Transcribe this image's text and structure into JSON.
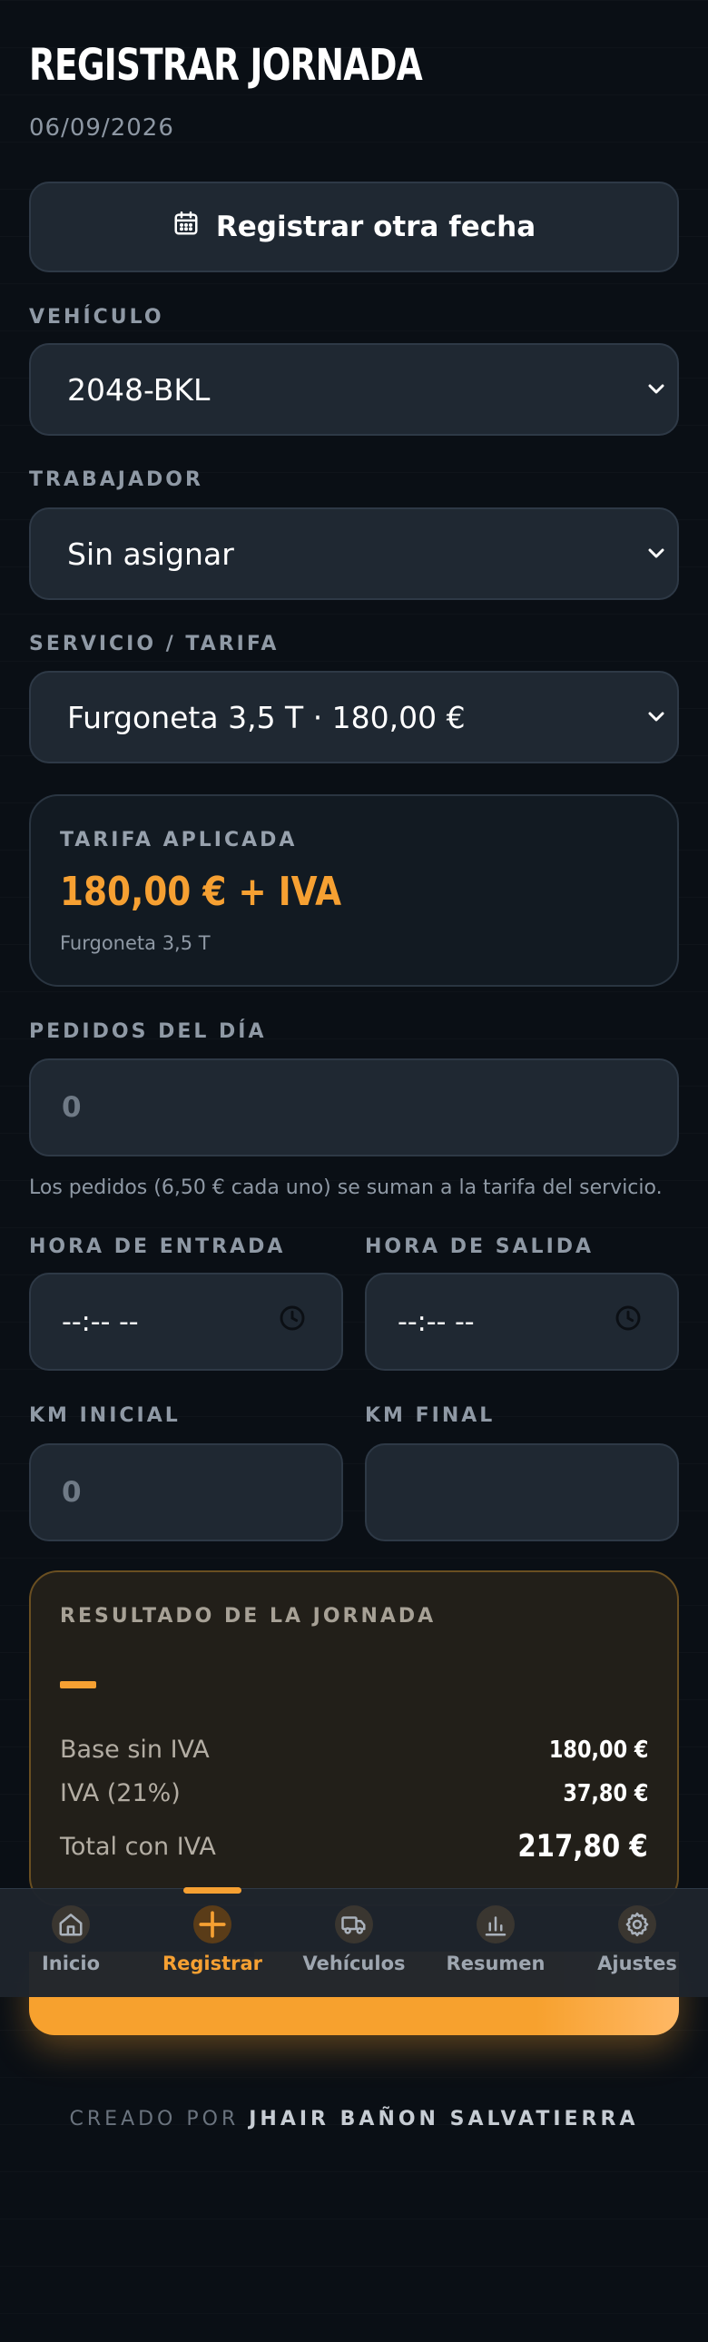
{
  "header": {
    "title": "REGISTRAR JORNADA",
    "date": "06/09/2026"
  },
  "other_date_button": {
    "label": "Registrar otra fecha",
    "icon": "calendar-icon"
  },
  "vehicle": {
    "label": "VEHÍCULO",
    "value": "2048-BKL"
  },
  "worker": {
    "label": "TRABAJADOR",
    "value": "Sin asignar"
  },
  "service": {
    "label": "SERVICIO / TARIFA",
    "value": "Furgoneta 3,5 T · 180,00 €"
  },
  "tariff": {
    "label": "TARIFA APLICADA",
    "value": "180,00 € + IVA",
    "sub": "Furgoneta 3,5 T"
  },
  "orders": {
    "label": "PEDIDOS DEL DÍA",
    "placeholder": "0",
    "hint": "Los pedidos (6,50 € cada uno) se suman a la tarifa del servicio."
  },
  "time_in": {
    "label": "HORA DE ENTRADA",
    "value": "--:-- --"
  },
  "time_out": {
    "label": "HORA DE SALIDA",
    "value": "--:-- --"
  },
  "km_start": {
    "label": "KM INICIAL",
    "placeholder": "0"
  },
  "km_end": {
    "label": "KM FINAL",
    "placeholder": ""
  },
  "result": {
    "label": "RESULTADO DE LA JORNADA",
    "rows": [
      {
        "key": "Base sin IVA",
        "value": "180,00 €"
      },
      {
        "key": "IVA (21%)",
        "value": "37,80 €"
      },
      {
        "key": "Total con IVA",
        "value": "217,80 €"
      }
    ]
  },
  "nav": [
    {
      "label": "Inicio",
      "icon": "home-icon"
    },
    {
      "label": "Registrar",
      "icon": "plus-icon",
      "active": true
    },
    {
      "label": "Vehículos",
      "icon": "truck-icon"
    },
    {
      "label": "Resumen",
      "icon": "bar-chart-icon"
    },
    {
      "label": "Ajustes",
      "icon": "gear-icon"
    }
  ],
  "footer": {
    "prefix": "CREADO POR",
    "author": "JHAIR BAÑON SALVATIERRA"
  },
  "colors": {
    "accent": "#f6a032",
    "background": "#0a0f15",
    "surface": "#1f2832"
  }
}
